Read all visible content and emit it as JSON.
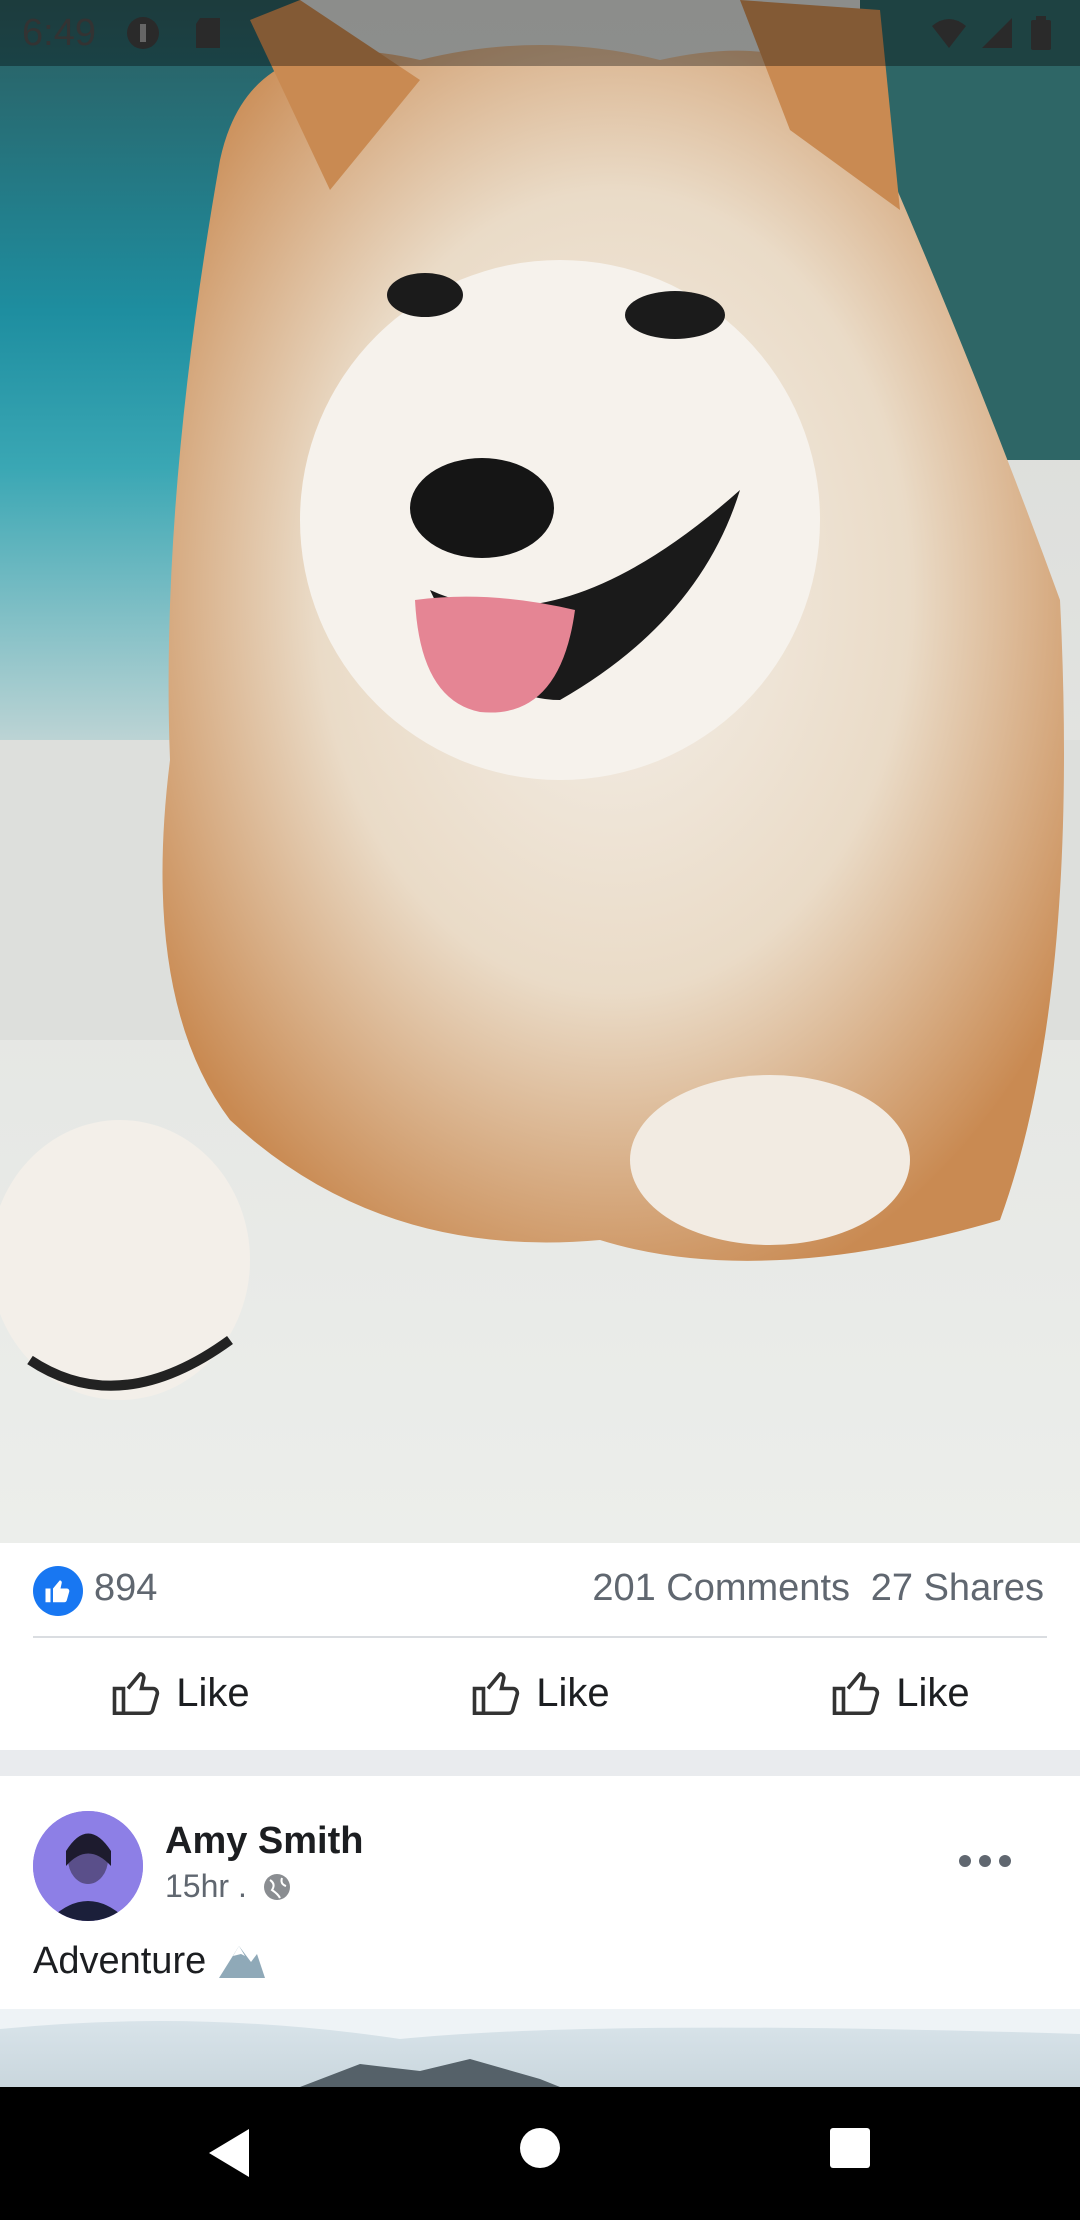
{
  "status_bar": {
    "time": "6:49",
    "icons": [
      "circle-app-icon",
      "sd-card-icon",
      "wifi-icon",
      "signal-icon",
      "battery-icon"
    ]
  },
  "photo": {
    "description_icon": "shiba-inu-photo"
  },
  "reactions": {
    "like_count": "894",
    "comments": "201 Comments",
    "shares": "27 Shares",
    "like_color": "#1877f2"
  },
  "actions": [
    {
      "label": "Like",
      "icon": "thumbs-up-icon"
    },
    {
      "label": "Like",
      "icon": "thumbs-up-icon"
    },
    {
      "label": "Like",
      "icon": "thumbs-up-icon"
    }
  ],
  "post": {
    "author": "Amy Smith",
    "time": "15hr .",
    "caption": "Adventure",
    "caption_emoji": "snow-capped-mountain-icon"
  },
  "nav": [
    "back-icon",
    "home-icon",
    "recents-icon"
  ]
}
